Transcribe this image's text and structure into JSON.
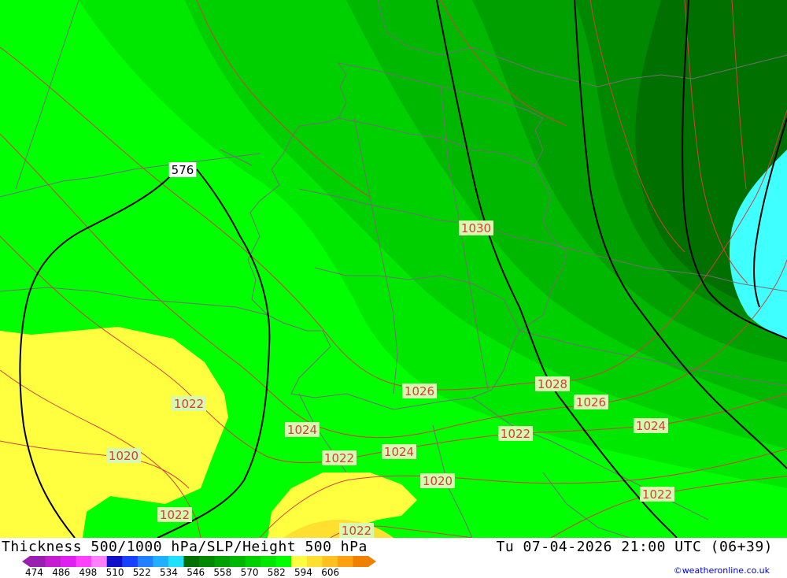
{
  "title": "Thickness 500/1000 hPa/SLP/Height 500 hPa",
  "datetime": "Tu 07-04-2026 21:00 UTC (06+39)",
  "credit": "©weatheronline.co.uk",
  "legend": {
    "ticks": [
      "474",
      "486",
      "498",
      "510",
      "522",
      "534",
      "546",
      "558",
      "570",
      "582",
      "594",
      "606"
    ],
    "colors": [
      "#9a1fb0",
      "#c41ed0",
      "#e020f0",
      "#ff40ff",
      "#ff80ff",
      "#1010c8",
      "#1a40ff",
      "#2080ff",
      "#20b0ff",
      "#20e0ff",
      "#007000",
      "#008800",
      "#00a000",
      "#00b800",
      "#00d000",
      "#00e800",
      "#00ff00",
      "#ffff40",
      "#ffe030",
      "#ffc020",
      "#ffa010",
      "#f08000"
    ]
  },
  "colors": {
    "yellow": "#ffff40",
    "cyan": "#40ffff",
    "isobar": "#d04040",
    "height_line": "#000000",
    "border": "#707070"
  },
  "height_labels": [
    "576"
  ],
  "isobar_labels": [
    "1030",
    "1028",
    "1026",
    "1026",
    "1024",
    "1024",
    "1024",
    "1022",
    "1022",
    "1022",
    "1022",
    "1022",
    "1020",
    "1020",
    "1022"
  ]
}
